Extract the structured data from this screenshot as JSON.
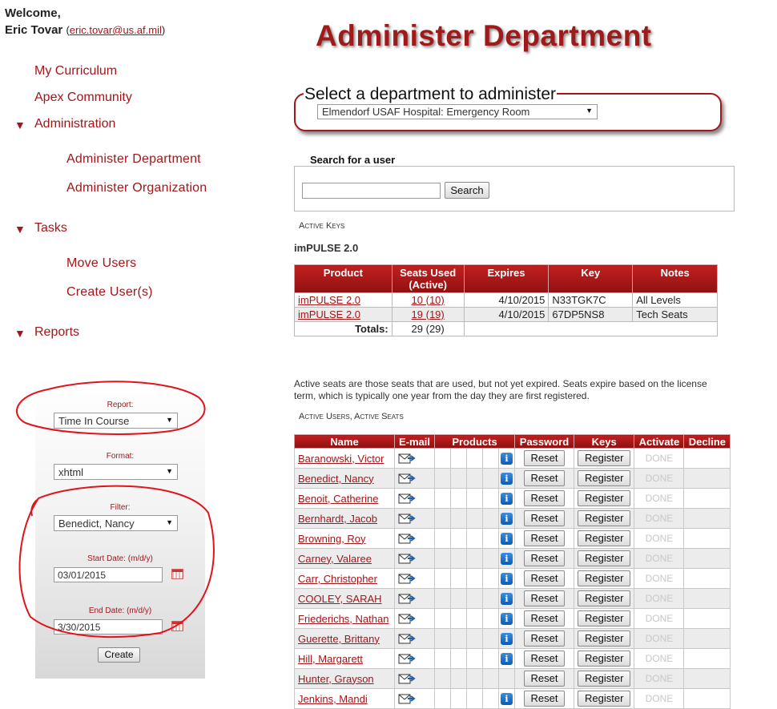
{
  "welcome": {
    "greeting": "Welcome,",
    "name": "Eric Tovar",
    "email": "eric.tovar@us.af.mil"
  },
  "sidebar": {
    "items": [
      {
        "label": "My Curriculum"
      },
      {
        "label": "Apex Community"
      },
      {
        "label": "Administration",
        "expanded": true,
        "children": [
          {
            "label": "Administer Department"
          },
          {
            "label": "Administer Organization"
          }
        ]
      },
      {
        "label": "Tasks",
        "expanded": true,
        "children": [
          {
            "label": "Move Users"
          },
          {
            "label": "Create User(s)"
          }
        ]
      },
      {
        "label": "Reports",
        "expanded": true
      }
    ],
    "expand_marker": "▼"
  },
  "report_panel": {
    "report_label": "Report:",
    "report_value": "Time In Course",
    "format_label": "Format:",
    "format_value": "xhtml",
    "filter_label": "Filter:",
    "filter_value": "Benedict, Nancy",
    "start_label": "Start Date: (m/d/y)",
    "start_value": "03/01/2015",
    "end_label": "End Date: (m/d/y)",
    "end_value": "3/30/2015",
    "create_label": "Create"
  },
  "main": {
    "title": "Administer Department",
    "dept_legend": "Select a department to administer",
    "dept_value": "Elmendorf USAF Hospital: Emergency Room",
    "search_title": "Search for a user",
    "search_button": "Search",
    "active_keys_heading": "Active Keys",
    "product_heading": "imPULSE 2.0",
    "keys_table": {
      "headers": [
        "Product",
        "Seats Used (Active)",
        "Expires",
        "Key",
        "Notes"
      ],
      "rows": [
        {
          "product": "imPULSE 2.0",
          "seats": "10 (10)",
          "expires": "4/10/2015",
          "key": "N33TGK7C",
          "notes": "All Levels"
        },
        {
          "product": "imPULSE 2.0",
          "seats": "19 (19)",
          "expires": "4/10/2015",
          "key": "67DP5NS8",
          "notes": "Tech Seats"
        }
      ],
      "totals_label": "Totals:",
      "totals_value": "29 (29)"
    },
    "seats_note": "Active seats are those seats that are used, but not yet expired. Seats expire based on the license term, which is typically one year from the day they are first registered.",
    "users_heading": "Active Users, Active Seats",
    "users_table": {
      "headers": [
        "Name",
        "E-mail",
        "Products",
        "Password",
        "Keys",
        "Activate",
        "Decline"
      ],
      "reset_label": "Reset",
      "register_label": "Register",
      "done_label": "DONE",
      "rows": [
        {
          "name": "Baranowski, Victor",
          "info": true
        },
        {
          "name": "Benedict, Nancy",
          "info": true
        },
        {
          "name": "Benoit, Catherine",
          "info": true
        },
        {
          "name": "Bernhardt, Jacob",
          "info": true
        },
        {
          "name": "Browning, Roy",
          "info": true
        },
        {
          "name": "Carney, Valaree",
          "info": true
        },
        {
          "name": "Carr, Christopher",
          "info": true
        },
        {
          "name": "COOLEY, SARAH",
          "info": true
        },
        {
          "name": "Friederichs, Nathan",
          "info": true
        },
        {
          "name": "Guerette, Brittany",
          "info": true
        },
        {
          "name": "Hill, Margarett",
          "info": true
        },
        {
          "name": "Hunter, Grayson",
          "info": false
        },
        {
          "name": "Jenkins, Mandi",
          "info": true
        }
      ]
    }
  },
  "colors": {
    "accent": "#a3161a",
    "header_red": "#b01a1a",
    "annotation": "#e0141a"
  },
  "icons": {
    "email": "envelope-arrow-icon",
    "info": "info-icon",
    "calendar": "calendar-icon",
    "expand": "triangle-down-icon"
  }
}
